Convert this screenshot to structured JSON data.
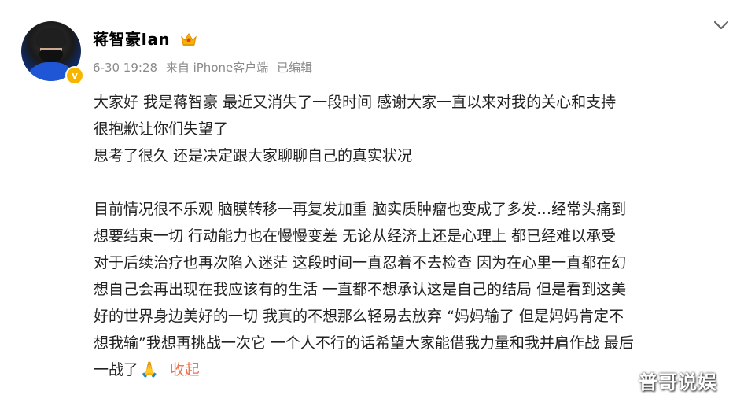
{
  "post": {
    "username": "蒋智豪Ian",
    "verified_badge": "v",
    "meta": {
      "date": "6-30 19:28",
      "source": "来自 iPhone客户端",
      "edited": "已编辑"
    },
    "lines": [
      "大家好 我是蒋智豪 最近又消失了一段时间 感谢大家一直以来对我的关心和支持",
      "很抱歉让你们失望了",
      "思考了很久 还是决定跟大家聊聊自己的真实状况",
      "",
      "目前情况很不乐观 脑膜转移一再复发加重 脑实质肿瘤也变成了多发…经常头痛到",
      "想要结束一切 行动能力也在慢慢变差 无论从经济上还是心理上 都已经难以承受",
      "对于后续治疗也再次陷入迷茫 这段时间一直忍着不去检查 因为在心里一直都在幻",
      "想自己会再出现在我应该有的生活 一直都不想承认这是自己的结局 但是看到这美",
      "好的世界身边美好的一切 我真的不想那么轻易去放弃 “妈妈输了 但是妈妈肯定不",
      "想我输”我想再挑战一次它 一个人不行的话希望大家能借我力量和我并肩作战 最后"
    ],
    "last_line": "一战了",
    "emoji": "🙏",
    "collapse_label": "收起"
  },
  "icons": {
    "crown": "crown-icon",
    "menu": "chevron-down-icon",
    "emoji": "praying-hands-icon"
  },
  "colors": {
    "accent_link": "#eb7350",
    "meta_gray": "#8a8a8a",
    "badge": "#f7b500"
  },
  "watermark": "普哥说娱"
}
